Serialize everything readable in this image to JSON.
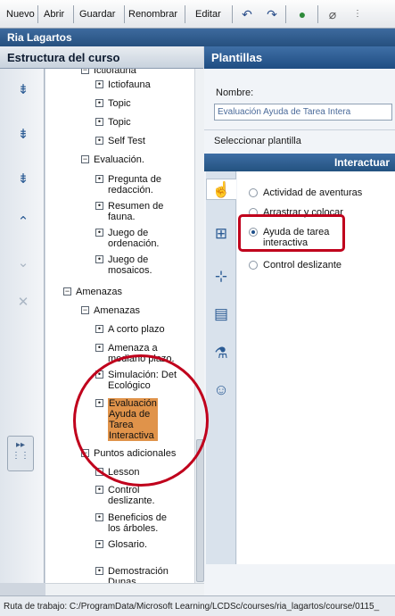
{
  "toolbar": {
    "nuevo": "Nuevo",
    "abrir": "Abrir",
    "guardar": "Guardar",
    "renombrar": "Renombrar",
    "editar": "Editar"
  },
  "app": {
    "title": "Ria Lagartos"
  },
  "left_panel": {
    "header": "Estructura del curso"
  },
  "tree": [
    {
      "label": "Ictiofauna",
      "box": "−"
    },
    {
      "label": "Ictiofauna",
      "box": "▪"
    },
    {
      "label": "Topic",
      "box": "▪"
    },
    {
      "label": "Topic",
      "box": "▪"
    },
    {
      "label": "Self Test",
      "box": "▪"
    },
    {
      "label": "Evaluación.",
      "box": "−"
    },
    {
      "label": "Pregunta de",
      "label2": "redacción.",
      "box": "▪"
    },
    {
      "label": "Resumen de",
      "label2": "fauna.",
      "box": "▪"
    },
    {
      "label": "Juego de",
      "label2": "ordenación.",
      "box": "▪"
    },
    {
      "label": "Juego de",
      "label2": "mosaicos.",
      "box": "▪"
    },
    {
      "label": "Amenazas",
      "box": "−"
    },
    {
      "label": "Amenazas",
      "box": "−"
    },
    {
      "label": "A corto plazo",
      "box": "▪"
    },
    {
      "label": "Amenaza a",
      "label2": "mediano plazo.",
      "box": "▪"
    },
    {
      "label": "Simulación: Det",
      "label2": "Ecológico",
      "box": "▪"
    },
    {
      "label": "Evaluación",
      "label2": "Ayuda de",
      "label3": "Tarea",
      "label4": "Interactiva",
      "box": "▪",
      "selected": true
    },
    {
      "label": "Puntos adicionales",
      "box": "−"
    },
    {
      "label": "Lesson",
      "box": "−"
    },
    {
      "label": "Control",
      "label2": "deslizante.",
      "box": "▪"
    },
    {
      "label": "Beneficios de",
      "label2": "los árboles.",
      "box": "▪"
    },
    {
      "label": "Glosario.",
      "box": "▪"
    },
    {
      "label": "Demostración",
      "label2": "Dunas",
      "box": "▪"
    }
  ],
  "right_panel": {
    "header": "Plantillas",
    "name_label": "Nombre:",
    "name_value": "Evaluación Ayuda de Tarea Intera",
    "select_label": "Seleccionar plantilla",
    "category": "Interactuar",
    "templates": [
      {
        "label": "Actividad de aventuras",
        "selected": false
      },
      {
        "label": "Arrastrar y colocar",
        "selected": false
      },
      {
        "label": "Ayuda de tarea",
        "label2": "interactiva",
        "selected": true
      },
      {
        "label": "Control deslizante",
        "selected": false
      }
    ]
  },
  "status": {
    "path": "Ruta de trabajo: C:/ProgramData/Microsoft Learning/LCDSc/courses/ria_lagartos/course/0115_"
  },
  "colors": {
    "accent": "#2a5a92",
    "selected": "#e0934a",
    "highlight": "#c0001c"
  }
}
